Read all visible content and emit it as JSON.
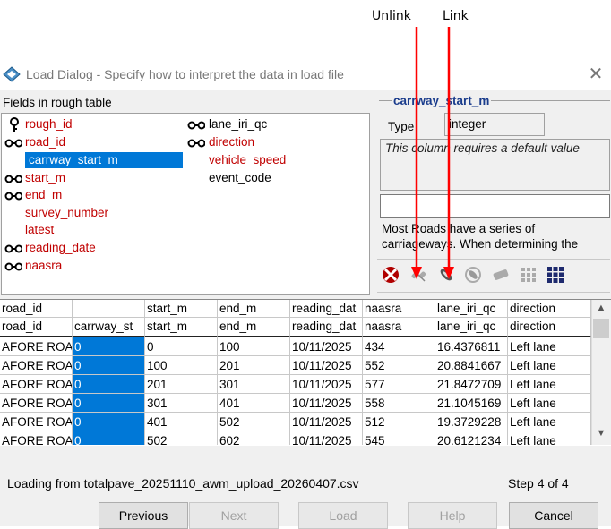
{
  "annotations": {
    "unlink": "Unlink",
    "link": "Link"
  },
  "window": {
    "title": "Load Dialog - Specify how to interpret the data in load file",
    "close": "✕"
  },
  "fields_panel": {
    "heading": "Fields in rough table",
    "col1": [
      "rough_id",
      "road_id",
      "carrway_start_m",
      "start_m",
      "end_m",
      "survey_number",
      "latest",
      "reading_date",
      "naasra"
    ],
    "col2": [
      "lane_iri_qc",
      "direction",
      "vehicle_speed",
      "event_code"
    ]
  },
  "details": {
    "field_name": "carrway_start_m",
    "type_label": "Type",
    "type_value": "integer",
    "default_note": "This column requires a default value",
    "help_text": "Most Roads have a series of carriageways. When determining the"
  },
  "grid": {
    "header1": [
      "road_id",
      "",
      "start_m",
      "end_m",
      "reading_dat",
      "naasra",
      "lane_iri_qc",
      "direction"
    ],
    "header2": [
      "road_id",
      "carrway_st",
      "start_m",
      "end_m",
      "reading_dat",
      "naasra",
      "lane_iri_qc",
      "direction"
    ],
    "rows": [
      [
        "AFORE ROAD",
        "0",
        "0",
        "100",
        "10/11/2025",
        "434",
        "16.4376811",
        "Left lane"
      ],
      [
        "AFORE ROAD",
        "0",
        "100",
        "201",
        "10/11/2025",
        "552",
        "20.8841667",
        "Left lane"
      ],
      [
        "AFORE ROAD",
        "0",
        "201",
        "301",
        "10/11/2025",
        "577",
        "21.8472709",
        "Left lane"
      ],
      [
        "AFORE ROAD",
        "0",
        "301",
        "401",
        "10/11/2025",
        "558",
        "21.1045169",
        "Left lane"
      ],
      [
        "AFORE ROAD",
        "0",
        "401",
        "502",
        "10/11/2025",
        "512",
        "19.3729228",
        "Left lane"
      ],
      [
        "AFORE ROAD",
        "0",
        "502",
        "602",
        "10/11/2025",
        "545",
        "20.6121234",
        "Left lane"
      ]
    ]
  },
  "status": {
    "loading": "Loading from totalpave_20251110_awm_upload_20260407.csv",
    "step": "Step 4 of 4"
  },
  "buttons": {
    "previous": "Previous",
    "next": "Next",
    "load": "Load",
    "help": "Help",
    "cancel": "Cancel"
  },
  "colors": {
    "red_arrow": "#ff0000",
    "selection": "#0078d7",
    "field_red": "#c00000",
    "heading_blue": "#1a3c8c"
  }
}
